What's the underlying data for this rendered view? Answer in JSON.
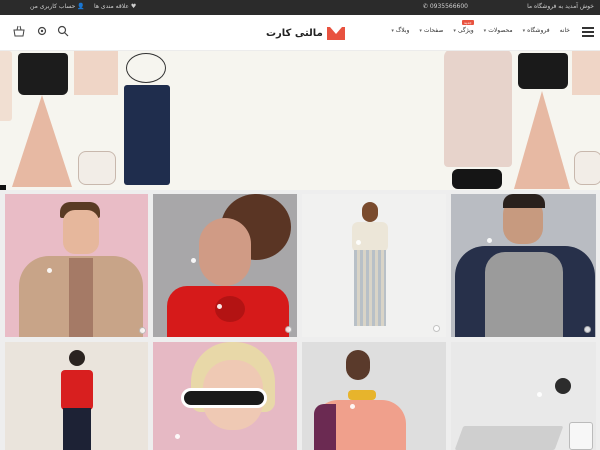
{
  "topbar": {
    "welcome": "خوش آمدید به فروشگاه ما",
    "phone": "0935566600",
    "wishlist": "علاقه مندی ها",
    "account": "حساب کاربری من"
  },
  "header": {
    "logo_text": "مالتی کارت",
    "nav": [
      {
        "label": "خانه"
      },
      {
        "label": "فروشگاه"
      },
      {
        "label": "محصولات"
      },
      {
        "label": "ویژگی",
        "badge": "جدید"
      },
      {
        "label": "صفحات"
      },
      {
        "label": "وبلاگ"
      }
    ],
    "icons": [
      "search-icon",
      "settings-icon",
      "basket-icon",
      "menu-icon"
    ]
  },
  "colors": {
    "accent": "#e8523f",
    "topbar": "#2b2b2b",
    "hero_bg": "#f6f5ef"
  }
}
